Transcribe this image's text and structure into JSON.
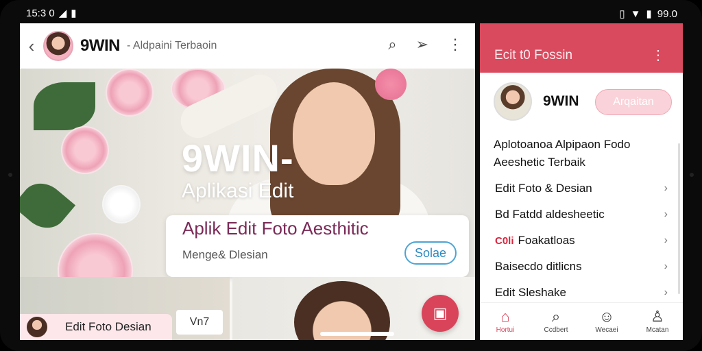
{
  "status_bar": {
    "time": "15:3 0",
    "battery": "99.0"
  },
  "left_app": {
    "brand": "9WIN",
    "header_subtitle": "- Aldpaini Terbaoin",
    "hero_title": "9WIN-",
    "hero_subtitle": "Aplikasi Edit",
    "card": {
      "title": "Aplik Edit Foto Aesthitic",
      "subtitle": "Menge& Dlesian",
      "button": "Solae"
    },
    "pill_label": "Edit Foto Desian",
    "tag": "Vn7"
  },
  "right_app": {
    "header_title": "Ecit t0 Fossin",
    "profile": {
      "name": "9WIN",
      "button": "Arqaitan"
    },
    "description": "Aplotoanoa Alpipaon Fodo Aeeshetic Terbaik",
    "menu": [
      {
        "label": "Edit Foto & Desian",
        "tag": ""
      },
      {
        "label": "Bd Fatdd aldesheetic",
        "tag": ""
      },
      {
        "label": "Foakatloas",
        "tag": "C0li"
      },
      {
        "label": "Baisecdo ditlicns",
        "tag": ""
      },
      {
        "label": "Edit Sleshake",
        "tag": ""
      }
    ],
    "nav": [
      {
        "label": "Hortui",
        "icon": "home-icon"
      },
      {
        "label": "Ccdbert",
        "icon": "search-icon"
      },
      {
        "label": "Wecaei",
        "icon": "face-icon"
      },
      {
        "label": "Mcatan",
        "icon": "profile-icon"
      }
    ]
  },
  "colors": {
    "accent": "#d94a5f",
    "link_blue": "#2d8ac1",
    "card_title": "#7a2a57"
  }
}
